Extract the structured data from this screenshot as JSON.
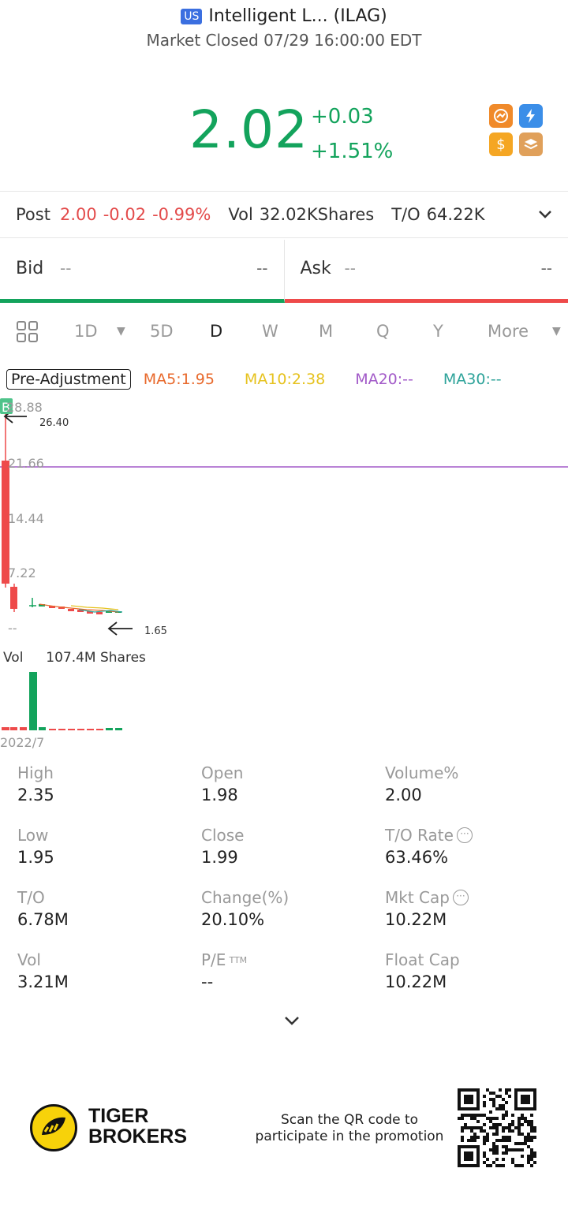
{
  "header": {
    "market_badge": "US",
    "title": "Intelligent L... (ILAG)",
    "status": "Market Closed 07/29 16:00:00 EDT"
  },
  "quote": {
    "price": "2.02",
    "change": "+0.03",
    "change_pct": "+1.51%"
  },
  "post": {
    "label": "Post",
    "price": "2.00",
    "change": "-0.02",
    "change_pct": "-0.99%",
    "vol_label": "Vol",
    "vol_value": "32.02KShares",
    "to_label": "T/O",
    "to_value": "64.22K"
  },
  "bid": {
    "label": "Bid",
    "price": "--",
    "size": "--"
  },
  "ask": {
    "label": "Ask",
    "price": "--",
    "size": "--"
  },
  "tabs": [
    "1D",
    "5D",
    "D",
    "W",
    "M",
    "Q",
    "Y",
    "More"
  ],
  "active_tab": "D",
  "ma": {
    "adjust_button": "Pre-Adjustment",
    "ma5": "MA5:1.95",
    "ma10": "MA10:2.38",
    "ma20": "MA20:--",
    "ma30": "MA30:--",
    "ma5_color": "#e8692c",
    "ma10_color": "#e6c21e",
    "ma20_color": "#a25ac8",
    "ma30_color": "#2ea39a"
  },
  "chart": {
    "badge": "B",
    "axis_ticks": [
      "28.88",
      "21.66",
      "14.44",
      "7.22",
      "--"
    ],
    "high_marker": "26.40",
    "low_marker": "1.65",
    "vol_label": "Vol",
    "vol_value": "107.4M Shares",
    "date": "2022/7"
  },
  "stats": {
    "high_label": "High",
    "high": "2.35",
    "open_label": "Open",
    "open": "1.98",
    "volpct_label": "Volume%",
    "volpct": "2.00",
    "low_label": "Low",
    "low": "1.95",
    "close_label": "Close",
    "close": "1.99",
    "torate_label": "T/O Rate",
    "torate": "63.46%",
    "to_label": "T/O",
    "to": "6.78M",
    "changepct_label": "Change(%)",
    "changepct": "20.10%",
    "mktcap_label": "Mkt Cap",
    "mktcap": "10.22M",
    "vol_label": "Vol",
    "vol": "3.21M",
    "pe_label": "P/E",
    "pe_sup": "TTM",
    "pe": "--",
    "floatcap_label": "Float Cap",
    "floatcap": "10.22M"
  },
  "footer": {
    "brand_line1": "TIGER",
    "brand_line2": "BROKERS",
    "promo_line1": "Scan the QR code to",
    "promo_line2": "participate in the promotion"
  },
  "colors": {
    "up": "#13a35c",
    "down": "#e34b4b",
    "accent": "#3b6fe0"
  }
}
